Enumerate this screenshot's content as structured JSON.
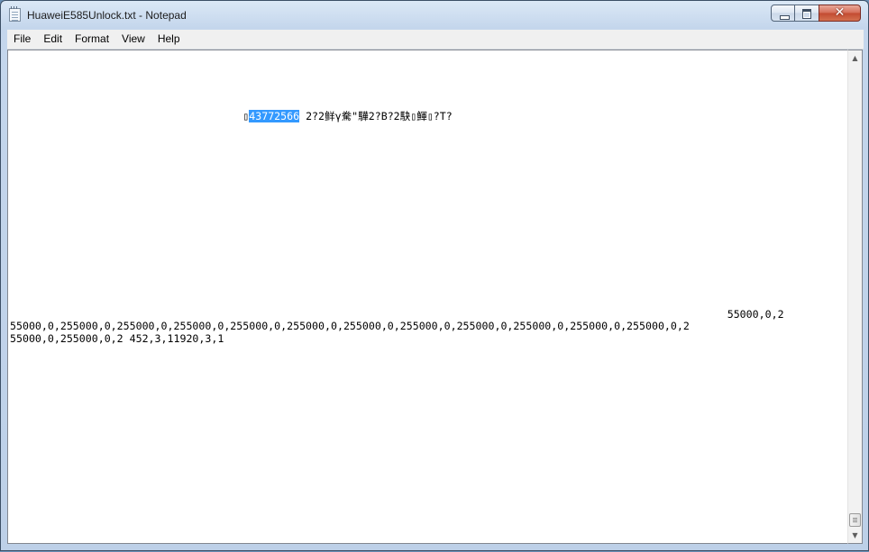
{
  "window": {
    "title": "HuaweiE585Unlock.txt - Notepad",
    "icon": "notepad-icon",
    "buttons": {
      "minimize": "minimize-icon",
      "maximize": "maximize-icon",
      "close": "close-icon"
    }
  },
  "menu": [
    {
      "label": "File"
    },
    {
      "label": "Edit"
    },
    {
      "label": "Format"
    },
    {
      "label": "View"
    },
    {
      "label": "Help"
    }
  ],
  "document": {
    "line1_prefix": "                                     ▯",
    "line1_selected": "43772566",
    "line1_suffix": " 2?2鲜γ駦\"驊2?B?2駃▯鯶▯?T?",
    "line2": "                                                                                                                  55000,0,2",
    "line3": "55000,0,255000,0,255000,0,255000,0,255000,0,255000,0,255000,0,255000,0,255000,0,255000,0,255000,0,255000,0,2",
    "line4": "55000,0,255000,0,2 452,3,11920,3,1"
  },
  "scrollbar": {
    "up": "▲",
    "down": "▼"
  }
}
